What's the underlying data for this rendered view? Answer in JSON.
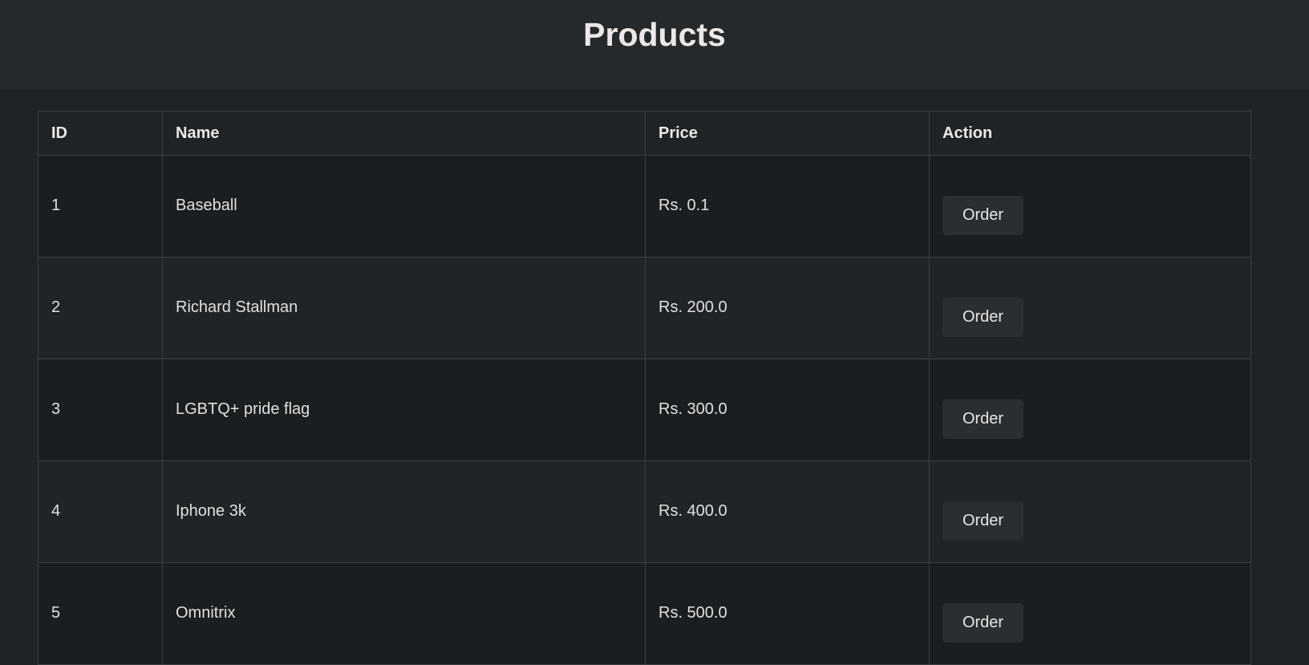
{
  "header": {
    "title": "Products"
  },
  "table": {
    "columns": [
      "ID",
      "Name",
      "Price",
      "Action"
    ],
    "rows": [
      {
        "id": "1",
        "name": "Baseball",
        "price": "Rs. 0.1",
        "action": "Order"
      },
      {
        "id": "2",
        "name": "Richard Stallman",
        "price": "Rs. 200.0",
        "action": "Order"
      },
      {
        "id": "3",
        "name": "LGBTQ+ pride flag",
        "price": "Rs. 300.0",
        "action": "Order"
      },
      {
        "id": "4",
        "name": "Iphone 3k",
        "price": "Rs. 400.0",
        "action": "Order"
      },
      {
        "id": "5",
        "name": "Omnitrix",
        "price": "Rs. 500.0",
        "action": "Order"
      }
    ]
  },
  "colors": {
    "page_bg": "#1f2325",
    "header_bg": "#26292b",
    "button_bg": "#2a2e31",
    "border": "#3c4044"
  }
}
